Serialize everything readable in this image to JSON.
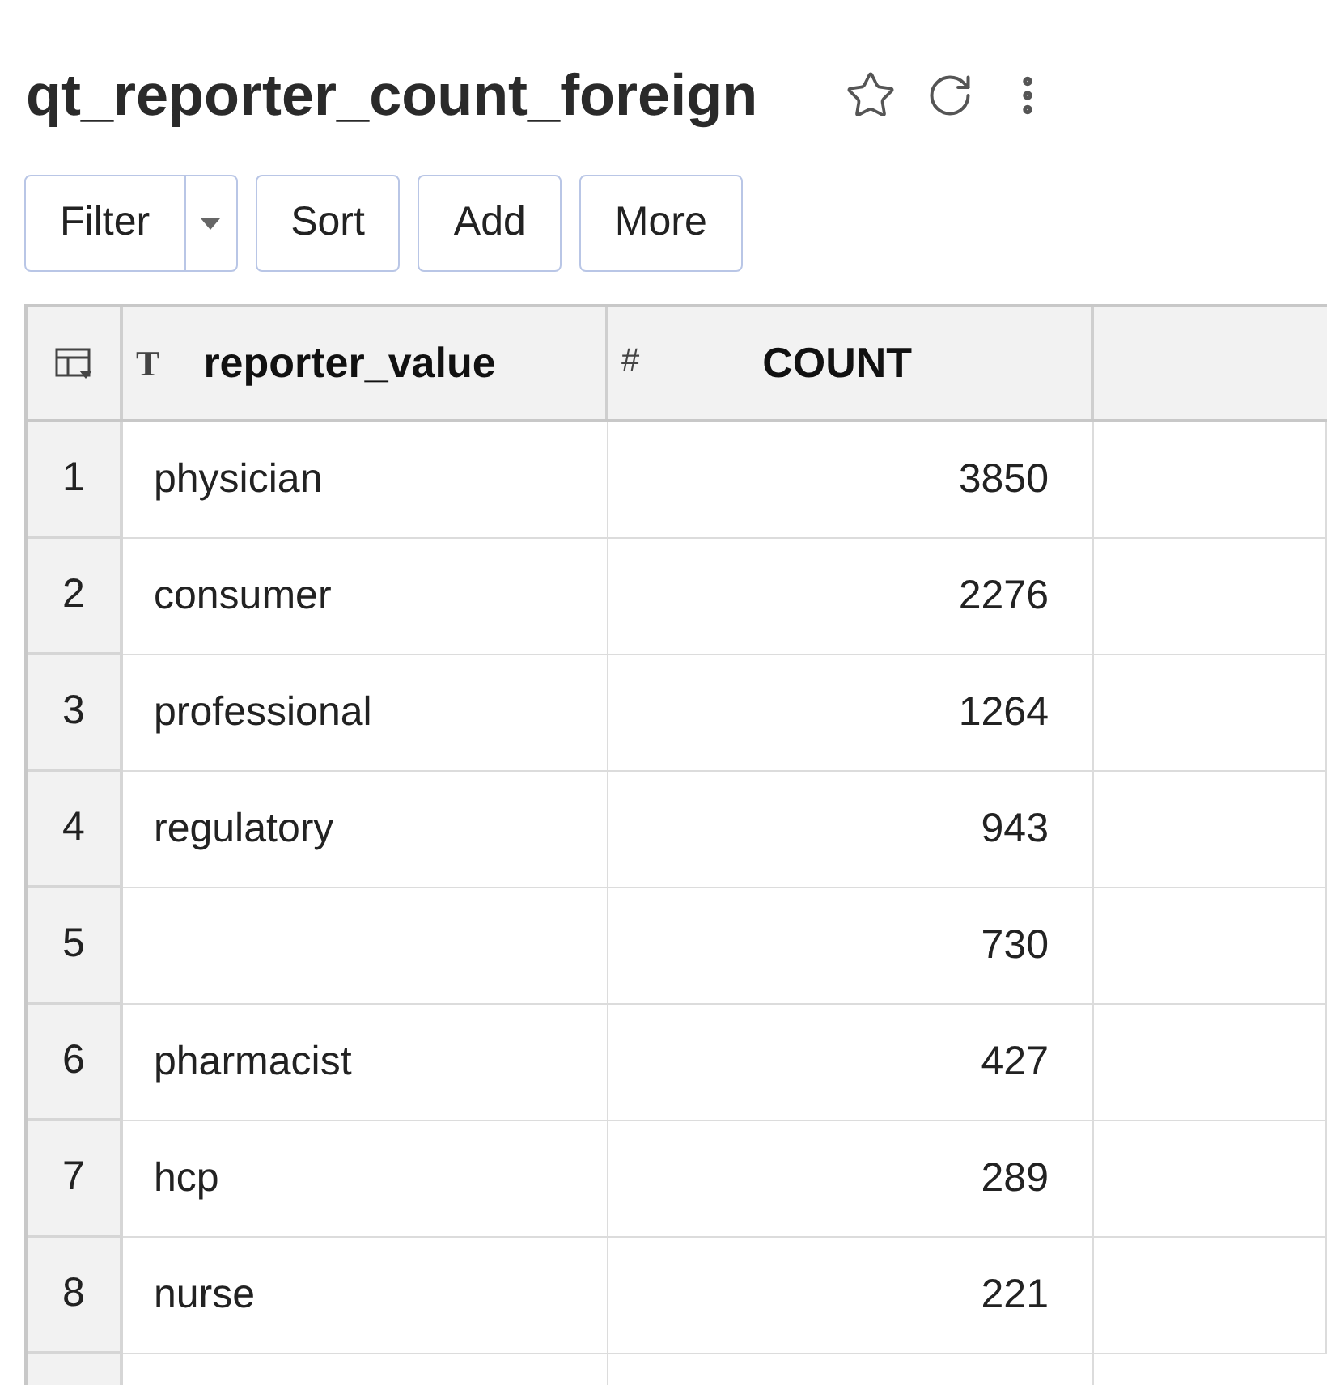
{
  "title": "qt_reporter_count_foreign",
  "toolbar": [
    {
      "label": "Filter",
      "kind": "split"
    },
    {
      "label": "Sort",
      "kind": "plain"
    },
    {
      "label": "Add",
      "kind": "plain"
    },
    {
      "label": "More",
      "kind": "plain"
    }
  ],
  "table": {
    "columns": [
      {
        "type_mark": "T",
        "label": "reporter_value",
        "kind": "text"
      },
      {
        "type_mark": "#",
        "label": "COUNT",
        "kind": "number"
      }
    ],
    "rows": [
      {
        "index": "1",
        "reporter_value": "physician",
        "count": "3850"
      },
      {
        "index": "2",
        "reporter_value": "consumer",
        "count": "2276"
      },
      {
        "index": "3",
        "reporter_value": "professional",
        "count": "1264"
      },
      {
        "index": "4",
        "reporter_value": "regulatory",
        "count": "943"
      },
      {
        "index": "5",
        "count": "730"
      },
      {
        "index": "6",
        "reporter_value": "pharmacist",
        "count": "427"
      },
      {
        "index": "7",
        "reporter_value": "hcp",
        "count": "289"
      },
      {
        "index": "8",
        "reporter_value": "nurse",
        "count": "221"
      }
    ]
  }
}
